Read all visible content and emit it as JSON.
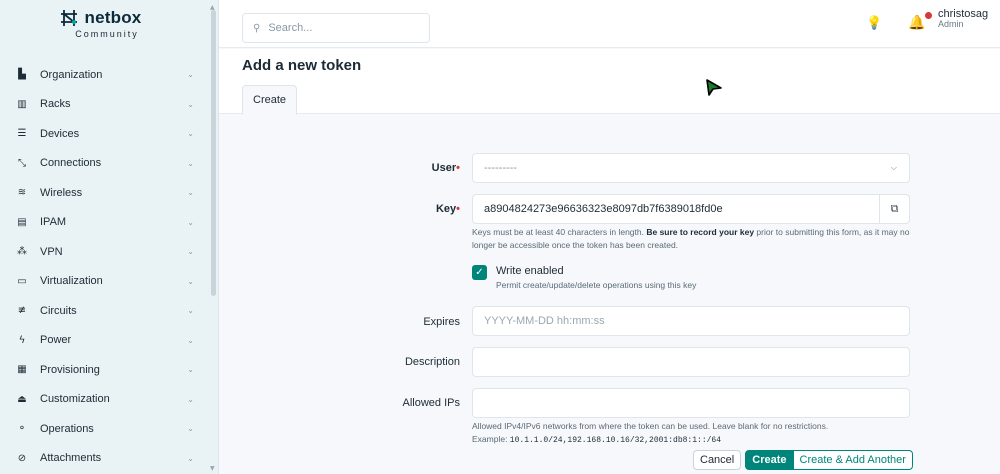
{
  "brand": {
    "name": "netbox",
    "subtitle": "Community"
  },
  "sidebar": {
    "items": [
      {
        "label": "Organization",
        "icon": "organization-icon",
        "glyph": "▙"
      },
      {
        "label": "Racks",
        "icon": "rack-icon",
        "glyph": "▥"
      },
      {
        "label": "Devices",
        "icon": "server-icon",
        "glyph": "☰"
      },
      {
        "label": "Connections",
        "icon": "connection-icon",
        "glyph": "⤡"
      },
      {
        "label": "Wireless",
        "icon": "wifi-icon",
        "glyph": "≋"
      },
      {
        "label": "IPAM",
        "icon": "ipam-icon",
        "glyph": "▤"
      },
      {
        "label": "VPN",
        "icon": "vpn-icon",
        "glyph": "⁂"
      },
      {
        "label": "Virtualization",
        "icon": "monitor-icon",
        "glyph": "▭"
      },
      {
        "label": "Circuits",
        "icon": "circuit-icon",
        "glyph": "≢"
      },
      {
        "label": "Power",
        "icon": "power-icon",
        "glyph": "ϟ"
      },
      {
        "label": "Provisioning",
        "icon": "file-icon",
        "glyph": "▦"
      },
      {
        "label": "Customization",
        "icon": "palette-icon",
        "glyph": "⏏"
      },
      {
        "label": "Operations",
        "icon": "operations-icon",
        "glyph": "⚬"
      },
      {
        "label": "Attachments",
        "icon": "paperclip-icon",
        "glyph": "⊘"
      }
    ]
  },
  "header": {
    "search_placeholder": "Search...",
    "user_name": "christosag",
    "user_role": "Admin"
  },
  "page": {
    "title": "Add a new token",
    "tab": "Create"
  },
  "form": {
    "user_label": "User",
    "user_value": "---------",
    "key_label": "Key",
    "key_value": "a8904824273e96636323e8097db7f6389018fd0e",
    "key_help_1": "Keys must be at least 40 characters in length. ",
    "key_help_bold": "Be sure to record your key",
    "key_help_2": " prior to submitting this form, as it may no longer be accessible once the token has been created.",
    "write_label": "Write enabled",
    "write_help": "Permit create/update/delete operations using this key",
    "write_checked": true,
    "expires_label": "Expires",
    "expires_placeholder": "YYYY-MM-DD hh:mm:ss",
    "description_label": "Description",
    "allowed_ips_label": "Allowed IPs",
    "allowed_ips_help": "Allowed IPv4/IPv6 networks from where the token can be used. Leave blank for no restrictions.",
    "allowed_ips_example_label": "Example: ",
    "allowed_ips_example": "10.1.1.0/24,192.168.10.16/32,2001:db8:1::/64"
  },
  "buttons": {
    "cancel": "Cancel",
    "create": "Create",
    "create_another": "Create & Add Another"
  },
  "colors": {
    "accent": "#00857a",
    "required": "#d63939",
    "sidebar_bg": "#e9f2f4"
  }
}
